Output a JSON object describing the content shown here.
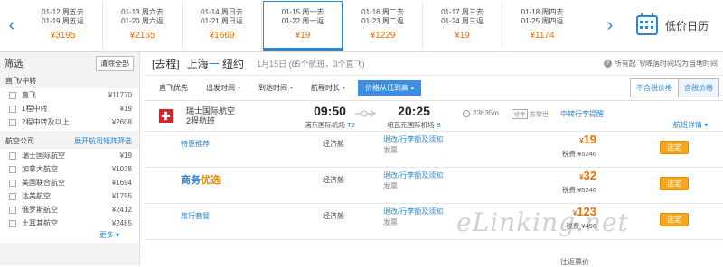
{
  "date_strip": {
    "prev_label": "‹",
    "next_label": "›",
    "dates": [
      {
        "go": "01-12 周五去",
        "ret": "01-19 周五返",
        "price": "¥3195",
        "active": false
      },
      {
        "go": "01-13 周六去",
        "ret": "01-20 周六返",
        "price": "¥2165",
        "active": false
      },
      {
        "go": "01-14 周日去",
        "ret": "01-21 周日返",
        "price": "¥1669",
        "active": false
      },
      {
        "go": "01-15 周一去",
        "ret": "01-22 周一返",
        "price": "¥19",
        "active": true
      },
      {
        "go": "01-16 周二去",
        "ret": "01-23 周二返",
        "price": "¥1229",
        "active": false
      },
      {
        "go": "01-17 周三去",
        "ret": "01-24 周三返",
        "price": "¥19",
        "active": false
      },
      {
        "go": "01-18 周四去",
        "ret": "01-25 周四返",
        "price": "¥1174",
        "active": false
      }
    ],
    "calendar_label": "低价日历"
  },
  "sidebar": {
    "title": "筛选",
    "clear_label": "清除全部",
    "direct_section": {
      "title": "直飞/中转",
      "items": [
        {
          "label": "直飞",
          "price": "¥11770"
        },
        {
          "label": "1程中转",
          "price": "¥19"
        },
        {
          "label": "2程中转及以上",
          "price": "¥2608"
        }
      ]
    },
    "airline_section": {
      "title": "航空公司",
      "link": "展开航司矩阵筛选",
      "items": [
        {
          "label": "瑞士国际航空",
          "price": "¥19"
        },
        {
          "label": "加拿大航空",
          "price": "¥1038"
        },
        {
          "label": "美国联合航空",
          "price": "¥1694"
        },
        {
          "label": "达美航空",
          "price": "¥1795"
        },
        {
          "label": "俄罗斯航空",
          "price": "¥2412"
        },
        {
          "label": "土耳其航空",
          "price": "¥2485"
        }
      ],
      "more": "更多 ▾"
    }
  },
  "route": {
    "tag": "[去程]",
    "from": "上海",
    "arrow": "一",
    "to": "纽约",
    "meta": "1月15日 (85个航班，3个直飞)",
    "note": "所有起飞/降落时间均为当地时间"
  },
  "sort": {
    "items": [
      {
        "label": "直飞优先",
        "caret": ""
      },
      {
        "label": "出发时间",
        "caret": "▾"
      },
      {
        "label": "到达时间",
        "caret": "▾"
      },
      {
        "label": "航程时长",
        "caret": "▾"
      }
    ],
    "active": {
      "label": "价格从低到高",
      "caret": "▴"
    },
    "tax_toggle": {
      "exclude": "不含税价格",
      "include": "含税价格"
    }
  },
  "flight": {
    "airline": "瑞士国际航空",
    "flights_count": "2程航班",
    "dep_time": "09:50",
    "dep_airport": "浦东国际机场",
    "dep_terminal": "T2",
    "arr_time": "20:25",
    "arr_airport": "纽瓦克国际机场",
    "arr_terminal": "B",
    "duration": "23h35m",
    "stop_box": "经停",
    "stop_city": "苏黎世",
    "remind": "中转行李提醒",
    "detail": "航班详情 ▾",
    "brand_color": "#d8232a"
  },
  "fares": [
    {
      "name": "特惠推荐",
      "cabin": "经济舱",
      "rules": "退改/行李额及须知",
      "invoice": "发票",
      "price": "19",
      "tax": "税费 ¥5246",
      "book": "选定"
    },
    {
      "name_part1": "商务",
      "name_part2": "优选",
      "cabin": "经济舱",
      "rules": "退改/行李额及须知",
      "invoice": "发票",
      "price": "32",
      "tax": "税费 ¥5246",
      "book": "选定"
    },
    {
      "name": "旅行套餐",
      "cabin": "经济舱",
      "rules": "退改/行李额及须知",
      "invoice": "发票",
      "price": "123",
      "tax": "税费 ¥496",
      "book": "选定"
    }
  ],
  "more_fares": "往返票价",
  "currency": "¥",
  "watermark": "eLinking.net",
  "colors": {
    "accent": "#2a86d8",
    "price": "#f06d00",
    "button": "#f5a623"
  }
}
